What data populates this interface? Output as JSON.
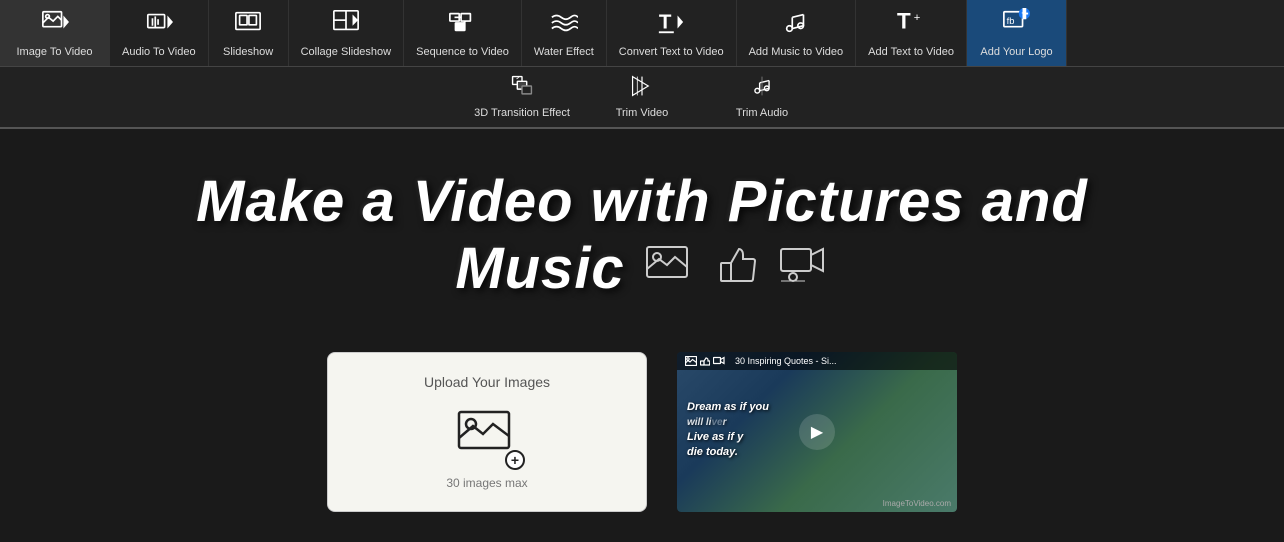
{
  "nav": {
    "items": [
      {
        "id": "image-to-video",
        "label": "Image To Video",
        "active": true
      },
      {
        "id": "audio-to-video",
        "label": "Audio To Video"
      },
      {
        "id": "slideshow",
        "label": "Slideshow"
      },
      {
        "id": "collage-slideshow",
        "label": "Collage Slideshow"
      },
      {
        "id": "sequence-to-video",
        "label": "Sequence to Video"
      },
      {
        "id": "water-effect",
        "label": "Water Effect"
      },
      {
        "id": "convert-text-to-video",
        "label": "Convert Text to Video"
      },
      {
        "id": "add-music-to-video",
        "label": "Add Music to Video"
      },
      {
        "id": "add-text-to-video",
        "label": "Add Text to Video"
      },
      {
        "id": "add-your-logo",
        "label": "Add Your Logo"
      }
    ],
    "second_row": [
      {
        "id": "3d-transition",
        "label": "3D Transition Effect"
      },
      {
        "id": "trim-video",
        "label": "Trim Video"
      },
      {
        "id": "trim-audio",
        "label": "Trim Audio"
      }
    ]
  },
  "hero": {
    "title_line1": "Make a Video with Pictures and",
    "title_line2": "Music"
  },
  "upload": {
    "label": "Upload Your Images",
    "limit": "30 images max"
  },
  "video_preview": {
    "title": "30 Inspiring Quotes - Si...",
    "line1": "Dream as if you",
    "line2": "will li",
    "line3": "Live as if y",
    "line4": "die today.",
    "branding": "ImageToVideo.com"
  }
}
